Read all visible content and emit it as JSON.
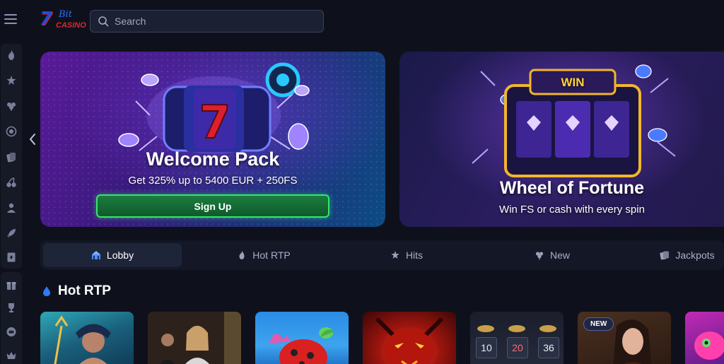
{
  "header": {
    "menu_icon": "hamburger-icon",
    "logo": {
      "number": "7",
      "brand": "Bit",
      "sub": "CASINO"
    },
    "search": {
      "placeholder": "Search",
      "icon": "search-icon"
    }
  },
  "sidebar": {
    "group1_icons": [
      "flame-icon",
      "stars-icon",
      "clover-icon",
      "target-icon",
      "slot-cards-icon",
      "cherries-icon",
      "live-dealer-icon",
      "rocket-icon",
      "card-deck-icon"
    ],
    "group2_icons": [
      "gift-icon",
      "trophy-icon",
      "crown-coin-icon",
      "vip-crown-icon"
    ]
  },
  "banners": [
    {
      "title": "Welcome Pack",
      "subtitle": "Get 325% up to 5400 EUR + 250FS",
      "button": "Sign Up",
      "art": "slot-reel-seven"
    },
    {
      "title": "Wheel of Fortune",
      "subtitle": "Win FS or cash with every spin",
      "sign": "WIN",
      "art": "slot-machine-win"
    }
  ],
  "tabs": [
    {
      "label": "Lobby",
      "icon": "lobby-icon",
      "active": true
    },
    {
      "label": "Hot RTP",
      "icon": "flame-icon",
      "active": false
    },
    {
      "label": "Hits",
      "icon": "stars-icon",
      "active": false
    },
    {
      "label": "New",
      "icon": "clover-icon",
      "active": false
    },
    {
      "label": "Jackpots",
      "icon": "jackpot-icon",
      "active": false
    }
  ],
  "section": {
    "title": "Hot RTP",
    "icon": "drop-flame-icon"
  },
  "games": [
    {
      "art": "poseidon"
    },
    {
      "art": "live-dealer"
    },
    {
      "art": "ladybug"
    },
    {
      "art": "red-dragon"
    },
    {
      "art": "roulette-numbers",
      "numbers": [
        "10",
        "20",
        "36"
      ]
    },
    {
      "art": "live-dealer-woman",
      "badge": "NEW"
    },
    {
      "art": "pink-creature"
    }
  ],
  "colors": {
    "background": "#0e111c",
    "accent_green": "#35e66c",
    "panel": "#131726"
  }
}
